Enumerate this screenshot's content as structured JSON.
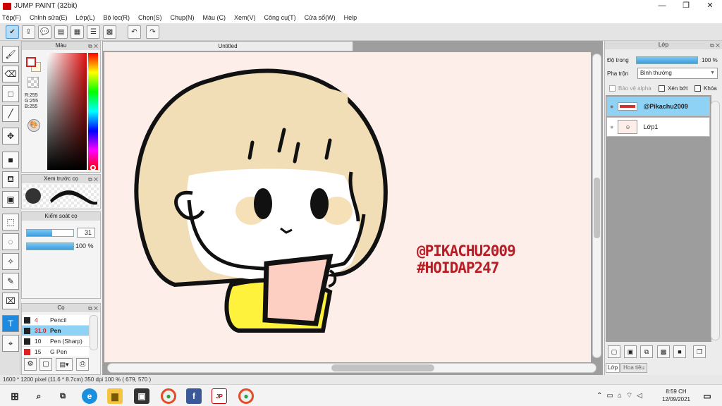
{
  "window": {
    "title": "JUMP PAINT (32bit)",
    "minimize": "—",
    "maximize": "❐",
    "close": "✕"
  },
  "menu": [
    "Tệp(F)",
    "Chỉnh sửa(E)",
    "Lớp(L)",
    "Bộ lọc(R)",
    "Chọn(S)",
    "Chụp(N)",
    "Màu (C)",
    "Xem(V)",
    "Công cụ(T)",
    "Cửa sổ(W)",
    "Help"
  ],
  "color_panel": {
    "title": "Màu",
    "r": "R:255",
    "g": "G:255",
    "b": "B:255"
  },
  "brush_preview": {
    "title": "Xem trước cọ"
  },
  "brush_control": {
    "title": "Kiểm soát cọ",
    "size": "31",
    "opacity": "100",
    "pct": "%",
    "size_fill": 0.55,
    "opacity_fill": 1.0
  },
  "brush_panel": {
    "title": "Cọ",
    "items": [
      {
        "size": "4",
        "name": "Pencil",
        "color": "#222222"
      },
      {
        "size": "31.0",
        "name": "Pen",
        "color": "#222222",
        "active": true
      },
      {
        "size": "10",
        "name": "Pen (Sharp)",
        "color": "#222222"
      },
      {
        "size": "15",
        "name": "G Pen",
        "color": "#e02020"
      }
    ]
  },
  "document": {
    "tab": "Untitled",
    "watermark_line1": "@PIKACHU2009",
    "watermark_line2": "#HOIDAP247"
  },
  "layers_panel": {
    "title": "Lớp",
    "opacity_label": "Độ trong",
    "opacity_value": "100 %",
    "opacity_fill": 1.0,
    "blend_label": "Pha trộn",
    "blend_value": "Bình thường",
    "protect_alpha": "Bảo vệ alpha",
    "clip": "Xén bớt",
    "lock": "Khóa",
    "layers": [
      {
        "name": "@Pikachu2009",
        "active": true
      },
      {
        "name": "Lớp1",
        "active": false
      }
    ],
    "tab_layer": "Lớp",
    "tab_pattern": "Hoa tiêu"
  },
  "status": {
    "text": "1600 * 1200 pixel   (11.6 * 8.7cm)   350 dpi   100 %   ( 679, 570 )"
  },
  "taskbar": {
    "time": "8:59 CH",
    "date": "12/09/2021"
  },
  "colors": {
    "accent": "#1e8be0",
    "watermark": "#b81c24",
    "canvas_bg": "#fdeeea",
    "hair": "#f1ddb6",
    "shirt": "#fff23c",
    "paper": "#fdcfc2"
  }
}
